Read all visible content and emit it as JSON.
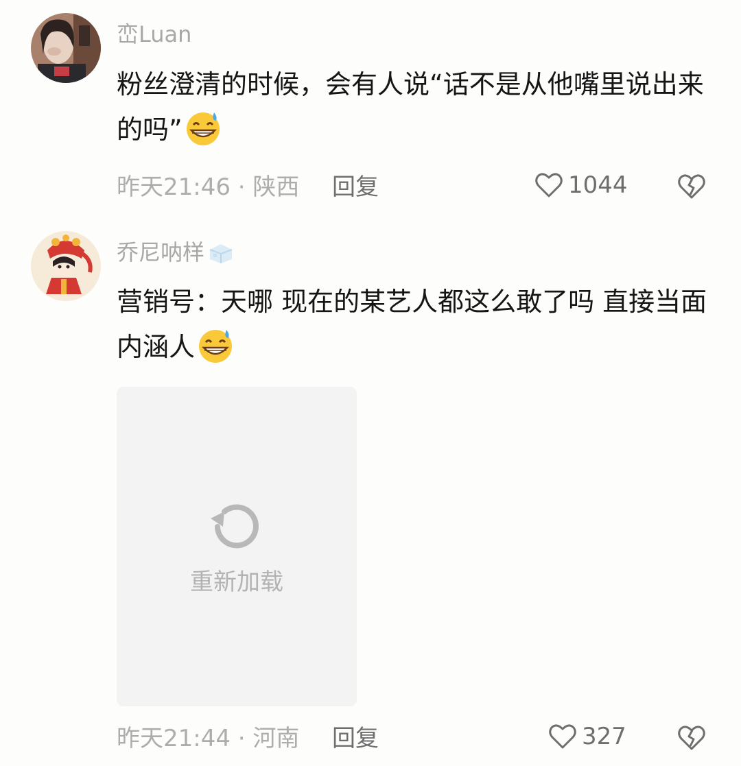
{
  "comments": [
    {
      "username": "峦Luan",
      "text": "粉丝澄清的时候，会有人说“话不是从他嘴里说出来的吗”",
      "emoji": "grinning-sweat-emoji",
      "time_location": "昨天21:46 · 陕西",
      "reply_label": "回复",
      "likes": "1044"
    },
    {
      "username": "乔尼呐样",
      "text": "营销号：天哪 现在的某艺人都这么敢了吗 直接当面内涵人",
      "emoji": "grinning-sweat-emoji",
      "reload_label": "重新加载",
      "time_location": "昨天21:44 · 河南",
      "reply_label": "回复",
      "likes": "327"
    }
  ],
  "icons": {
    "like": "heart-outline-icon",
    "dislike": "broken-heart-icon",
    "reload": "refresh-icon",
    "badge": "ice-cube-badge"
  },
  "colors": {
    "background": "#fdfdfb",
    "text": "#151515",
    "meta": "#adadad",
    "action": "#6e6e6e",
    "placeholder": "#f3f3f3"
  }
}
